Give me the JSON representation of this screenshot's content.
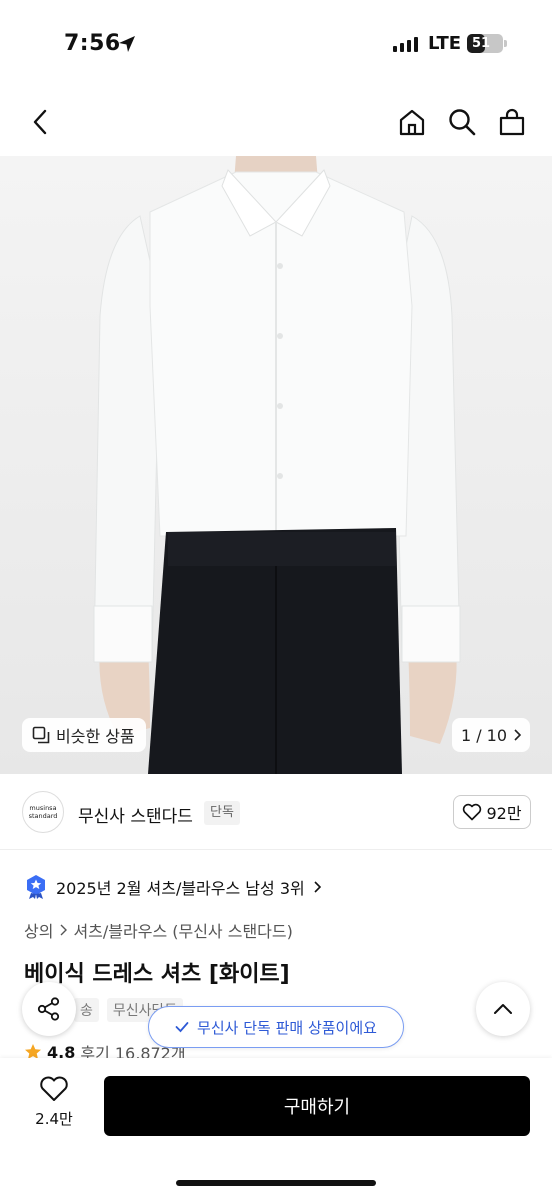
{
  "status_bar": {
    "time": "7:56",
    "network": "LTE",
    "battery": "51",
    "battery_level": 0.51
  },
  "nav": {
    "icons": [
      "back-icon",
      "home-icon",
      "search-icon",
      "cart-icon"
    ]
  },
  "hero": {
    "similar_label": "비슷한 상품",
    "page_indicator": "1 / 10"
  },
  "brand": {
    "logo_line1": "musinsa",
    "logo_line2": "standard",
    "name": "무신사 스탠다드",
    "tag": "단독",
    "likes": "92만"
  },
  "ranking": {
    "text": "2025년 2월 셔츠/블라우스 남성 3위"
  },
  "breadcrumb": {
    "level1": "상의",
    "level2": "셔츠/블라우스 (무신사 스탠다드)"
  },
  "product": {
    "title": "베이식 드레스 셔츠 [화이트]",
    "tag1": "송",
    "tag2": "무신사단독",
    "rating": "4.8",
    "reviews": "후기 16,872개"
  },
  "toast": {
    "text": "무신사 단독 판매 상품이에요"
  },
  "bottom_bar": {
    "wish_count": "2.4만",
    "buy_label": "구매하기"
  },
  "colors": {
    "accent_blue": "#2e5ad6",
    "star": "#f5a623",
    "buy_button": "#000000"
  }
}
